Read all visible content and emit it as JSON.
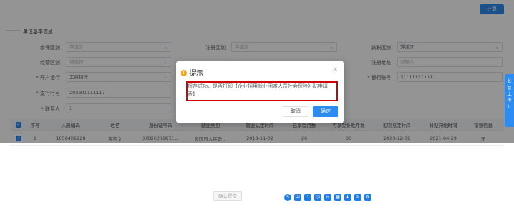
{
  "toolbar": {
    "calc_label": "计算"
  },
  "section": {
    "title": "单位基本信息"
  },
  "form": {
    "row1": [
      {
        "label": "参保区划",
        "value": "萍溪区",
        "placeholder": true
      },
      {
        "label": "注册区划",
        "value": "萍溪区",
        "placeholder": true
      },
      {
        "label": "纳税区划",
        "value": "萍溪区",
        "placeholder": false
      }
    ],
    "row2": [
      {
        "label": "经营区划",
        "value": "请选择",
        "placeholder": true
      },
      {
        "label": "经营地址",
        "value": "",
        "placeholder": true
      },
      {
        "label": "注册地址",
        "value": "请输入",
        "placeholder": true
      }
    ],
    "row3": [
      {
        "label": "* 开户银行",
        "value": "工商银行"
      },
      {
        "label": "* 银行账号",
        "value": "11111111111"
      }
    ],
    "row4": [
      {
        "label": "* 支行行号",
        "value": "203501111117"
      }
    ],
    "row5": [
      {
        "label": "* 联系人",
        "value": "1"
      }
    ]
  },
  "table": {
    "headers": [
      "序号",
      "人员编码",
      "姓名",
      "身份证号码",
      "就业类别",
      "就业认定时间",
      "已享受月数",
      "可享受补贴月数",
      "初次核定时间",
      "补贴开始时间",
      "错误信息"
    ],
    "rows": [
      [
        "1",
        "1050409228",
        "蒋亦文",
        "32020219971...",
        "设区市人民政...",
        "2018-11-02",
        "26",
        "36",
        "2020-12-01",
        "2021-04-29",
        "无"
      ]
    ]
  },
  "side_tab": {
    "label": "长\n智\n上\n传\n》"
  },
  "footer": {
    "submit_label": "确认提交"
  },
  "ime_toolbar": {
    "icons": [
      "ime-logo-icon",
      "中",
      "·",
      "smile-icon",
      "tools-icon",
      "keyboard-icon",
      "user-icon",
      "shirt-icon",
      "gear-icon"
    ]
  },
  "dialog": {
    "title": "提示",
    "message": "保存成功，是否打印【企业招用就业困难人员社会保险补贴申请表】",
    "cancel_label": "取消",
    "ok_label": "确定",
    "close_label": "×"
  },
  "colors": {
    "accent": "#2d8cf0",
    "highlight": "#d40000",
    "warning": "#f5a623"
  }
}
